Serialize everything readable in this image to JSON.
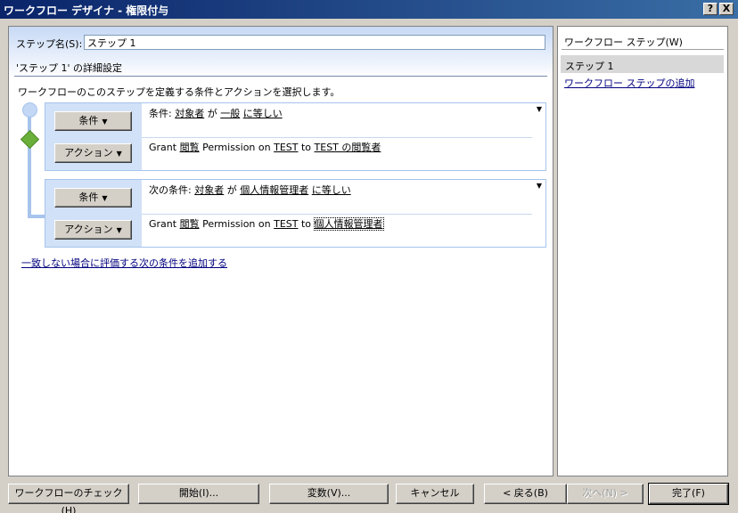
{
  "window": {
    "title": "ワークフロー デザイナ - 権限付与",
    "help_label": "?",
    "close_label": "X"
  },
  "step": {
    "name_label": "ステップ名(S):",
    "name_value": "ステップ 1",
    "details_title": "'ステップ 1' の詳細設定",
    "instruction": "ワークフローのこのステップを定義する条件とアクションを選択します。"
  },
  "rules": [
    {
      "condition_button": "条件",
      "action_button": "アクション",
      "condition": {
        "prefix": "条件:",
        "field": "対象者",
        "op1": "が",
        "value": "一般",
        "op2": "に等しい"
      },
      "action": {
        "prefix": "Grant",
        "perm": "閲覧",
        "mid1": "Permission on",
        "target": "TEST",
        "mid2": "to",
        "recipient": "TEST の閲覧者"
      }
    },
    {
      "condition_button": "条件",
      "action_button": "アクション",
      "condition": {
        "prefix": "次の条件:",
        "field": "対象者",
        "op1": "が",
        "value": "個人情報管理者",
        "op2": "に等しい"
      },
      "action": {
        "prefix": "Grant",
        "perm": "閲覧",
        "mid1": "Permission on",
        "target": "TEST",
        "mid2": "to",
        "recipient": "個人情報管理者"
      }
    }
  ],
  "add_else_link": "一致しない場合に評価する次の条件を追加する",
  "sidebar": {
    "title": "ワークフロー ステップ(W)",
    "selected_step": "ステップ 1",
    "add_link": "ワークフロー ステップの追加"
  },
  "buttons": {
    "check": "ワークフローのチェック(H)",
    "init": "開始(I)...",
    "vars": "変数(V)...",
    "cancel": "キャンセル",
    "back": "< 戻る(B)",
    "next": "次へ(N) >",
    "finish": "完了(F)"
  }
}
